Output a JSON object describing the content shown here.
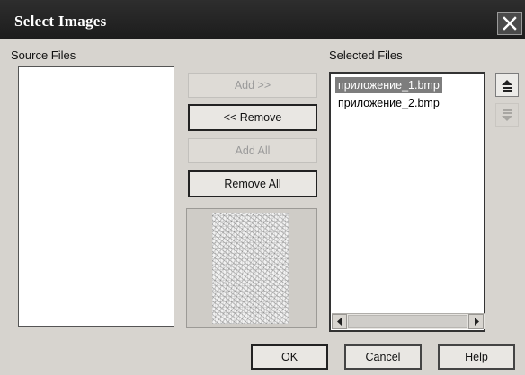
{
  "window": {
    "title": "Select Images"
  },
  "source": {
    "label": "Source Files",
    "items": []
  },
  "selected": {
    "label": "Selected Files",
    "items": [
      {
        "name": "приложение_1.bmp",
        "selected": true
      },
      {
        "name": "приложение_2.bmp",
        "selected": false
      }
    ]
  },
  "buttons": {
    "add": "Add >>",
    "remove": "<< Remove",
    "add_all": "Add All",
    "remove_all": "Remove All",
    "ok": "OK",
    "cancel": "Cancel",
    "help": "Help"
  },
  "icons": {
    "close": "close-icon",
    "move_up": "move-up-icon",
    "move_down": "move-down-icon",
    "scroll_left": "arrow-left-icon",
    "scroll_right": "arrow-right-icon"
  },
  "colors": {
    "titlebar": "#222222",
    "selection": "#7d7d7d",
    "dialog_background": "#d7d4cf"
  }
}
